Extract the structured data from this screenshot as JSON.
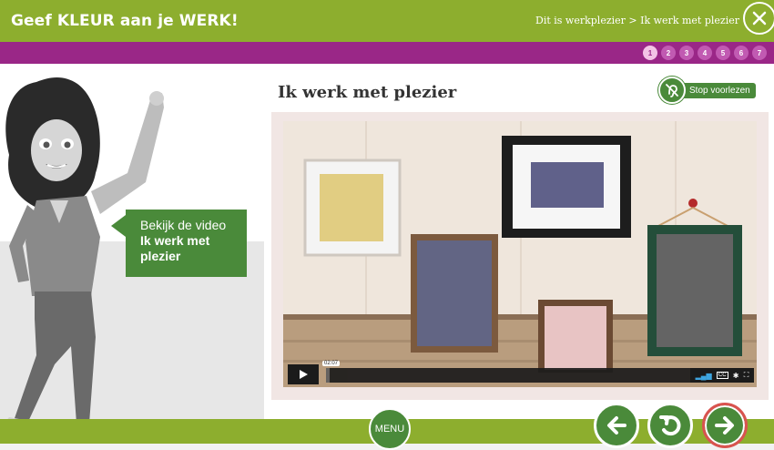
{
  "header": {
    "app_title": "Geef KLEUR aan je WERK!",
    "breadcrumb": "Dit is werkplezier > Ik werk met plezier"
  },
  "pagination": {
    "pages": [
      "1",
      "2",
      "3",
      "4",
      "5",
      "6",
      "7"
    ],
    "current": "1"
  },
  "main": {
    "title": "Ik werk met plezier",
    "stop_reading_label": "Stop voorlezen"
  },
  "speech_bubble": {
    "text_plain": "Bekijk de video ",
    "text_bold": "Ik werk met plezier"
  },
  "video": {
    "time": "02:07",
    "progress": 0.01,
    "controls": [
      "volume-icon",
      "cc-icon",
      "settings-icon",
      "fullscreen-icon"
    ]
  },
  "footer": {
    "menu_label": "MENU"
  },
  "colors": {
    "header_green": "#8dae2e",
    "purple_bar": "#9a2787",
    "button_green": "#4a8a3a",
    "next_ring": "#d9534f"
  }
}
